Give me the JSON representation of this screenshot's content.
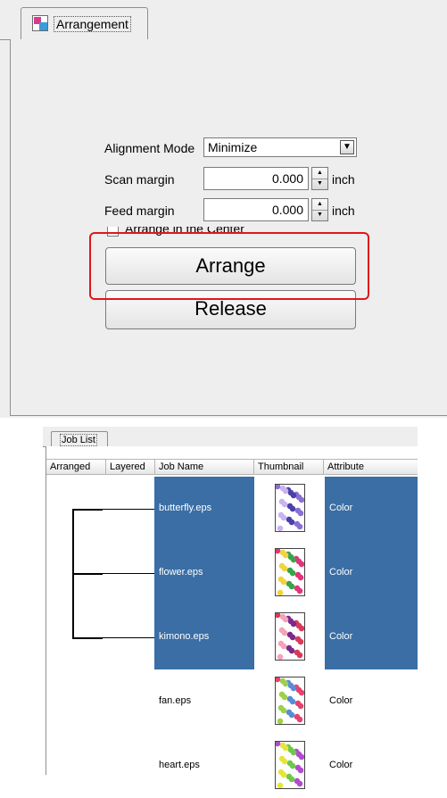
{
  "arrangement_panel": {
    "tab_label": "Arrangement",
    "tab_icon": "arrangement-icon",
    "alignment_mode": {
      "label": "Alignment Mode",
      "value": "Minimize"
    },
    "scan_margin": {
      "label": "Scan margin",
      "value": "0.000",
      "unit": "inch"
    },
    "feed_margin": {
      "label": "Feed margin",
      "value": "0.000",
      "unit": "inch"
    },
    "arrange_in_center": {
      "label": "Arrange in the Center",
      "checked": false
    },
    "arrange_button": "Arrange",
    "release_button": "Release",
    "highlight_color": "#e0161a"
  },
  "job_list": {
    "tab_label": "Job List",
    "columns": [
      "Arranged",
      "Layered",
      "Job Name",
      "Thumbnail",
      "Attribute"
    ],
    "selection_color": "#3a6ea5",
    "rows": [
      {
        "name": "butterfly.eps",
        "attribute": "Color",
        "selected": true,
        "thumb_colors": [
          "#8a6fd6",
          "#c9b3f0",
          "#4b3fa8"
        ]
      },
      {
        "name": "flower.eps",
        "attribute": "Color",
        "selected": true,
        "thumb_colors": [
          "#e3337a",
          "#f2d33a",
          "#3aa34a"
        ]
      },
      {
        "name": "kimono.eps",
        "attribute": "Color",
        "selected": true,
        "thumb_colors": [
          "#d93a5a",
          "#f4a3b8",
          "#7a2a8a"
        ]
      },
      {
        "name": "fan.eps",
        "attribute": "Color",
        "selected": false,
        "thumb_colors": [
          "#e54270",
          "#9fd04a",
          "#5a8ad8"
        ]
      },
      {
        "name": "heart.eps",
        "attribute": "Color",
        "selected": false,
        "thumb_colors": [
          "#b34bd0",
          "#e5e53a",
          "#6fc84b"
        ]
      }
    ]
  }
}
